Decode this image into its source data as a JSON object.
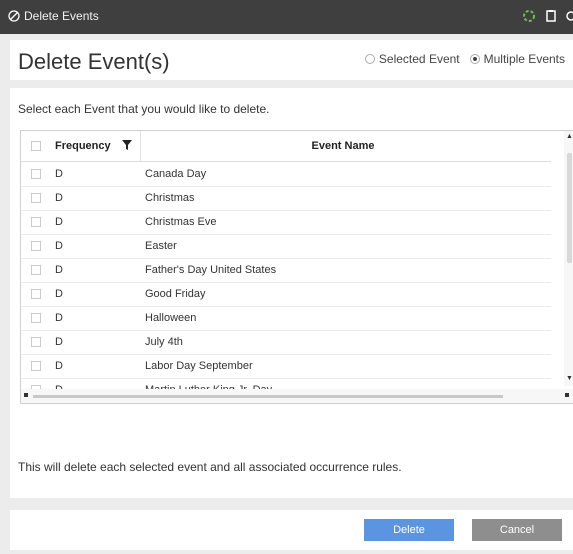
{
  "window": {
    "title": "Delete Events"
  },
  "header": {
    "title": "Delete Event(s)",
    "radio": {
      "selected_label": "Selected Event",
      "multiple_label": "Multiple Events",
      "selected_option": "Multiple Events"
    }
  },
  "instructions": "Select each Event that you would like to delete.",
  "table": {
    "columns": {
      "frequency": "Frequency",
      "event_name": "Event Name"
    },
    "rows": [
      {
        "frequency": "D",
        "name": "Canada Day"
      },
      {
        "frequency": "D",
        "name": "Christmas"
      },
      {
        "frequency": "D",
        "name": "Christmas Eve"
      },
      {
        "frequency": "D",
        "name": "Easter"
      },
      {
        "frequency": "D",
        "name": "Father's Day United States"
      },
      {
        "frequency": "D",
        "name": "Good Friday"
      },
      {
        "frequency": "D",
        "name": "Halloween"
      },
      {
        "frequency": "D",
        "name": "July 4th"
      },
      {
        "frequency": "D",
        "name": "Labor Day September"
      },
      {
        "frequency": "D",
        "name": "Martin Luther King Jr. Day"
      }
    ]
  },
  "note": "This will delete each selected event and all associated occurrence rules.",
  "buttons": {
    "delete": "Delete",
    "cancel": "Cancel"
  },
  "colors": {
    "titlebar": "#3f3f3f",
    "delete_button": "#5b95e2",
    "cancel_button": "#8e8e8e",
    "loading_icon": "#6cc04a"
  },
  "icons": {
    "app": "no-entry-icon",
    "titlebar_controls": [
      "refresh-icon",
      "document-icon",
      "close-icon"
    ],
    "column_filter": "filter-icon"
  }
}
